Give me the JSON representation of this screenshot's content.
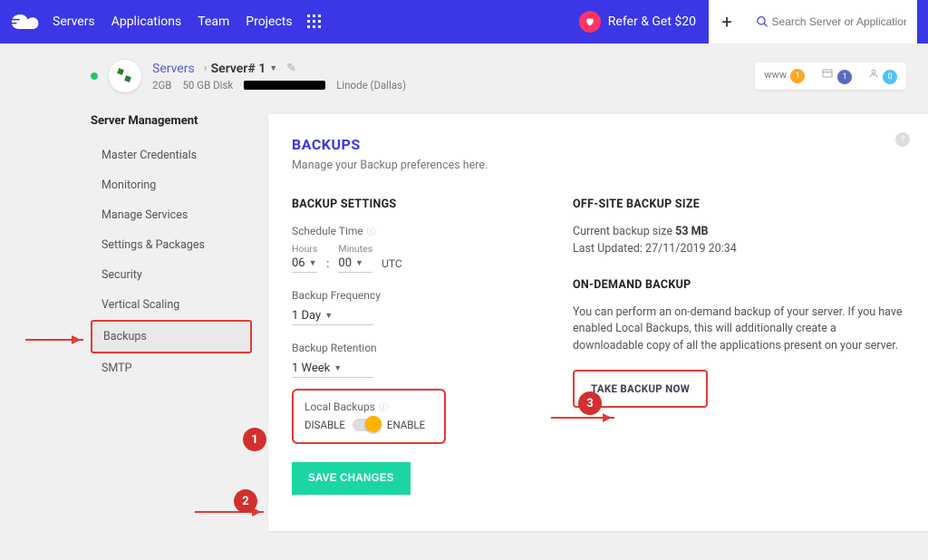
{
  "nav": {
    "items": [
      "Servers",
      "Applications",
      "Team",
      "Projects"
    ],
    "refer": "Refer & Get $20",
    "search_placeholder": "Search Server or Application"
  },
  "server": {
    "breadcrumb": "Servers",
    "name": "Server# 1",
    "ram": "2GB",
    "disk": "50 GB Disk",
    "provider": "Linode (Dallas)",
    "badges": {
      "www_label": "www",
      "www": "1",
      "app": "1",
      "user": "0"
    }
  },
  "sidebar": {
    "title": "Server Management",
    "items": [
      "Master Credentials",
      "Monitoring",
      "Manage Services",
      "Settings & Packages",
      "Security",
      "Vertical Scaling",
      "Backups",
      "SMTP"
    ],
    "active_index": 6
  },
  "page": {
    "title": "BACKUPS",
    "subtitle": "Manage your Backup preferences here."
  },
  "settings": {
    "heading": "BACKUP SETTINGS",
    "schedule_label": "Schedule Time",
    "hours_label": "Hours",
    "minutes_label": "Minutes",
    "hours": "06",
    "minutes": "00",
    "tz": "UTC",
    "freq_label": "Backup Frequency",
    "freq_value": "1 Day",
    "retention_label": "Backup Retention",
    "retention_value": "1 Week",
    "local_label": "Local Backups",
    "disable": "DISABLE",
    "enable": "ENABLE",
    "save": "SAVE CHANGES"
  },
  "offsite": {
    "heading": "OFF-SITE BACKUP SIZE",
    "size_line": "Current backup size",
    "size_value": "53 MB",
    "updated": "Last Updated: 27/11/2019 20:34"
  },
  "ondemand": {
    "heading": "ON-DEMAND BACKUP",
    "text": "You can perform an on-demand backup of your server. If you have enabled Local Backups, this will additionally create a downloadable copy of all the applications present on your server.",
    "button": "TAKE BACKUP NOW"
  },
  "annotations": {
    "c1": "1",
    "c2": "2",
    "c3": "3"
  }
}
